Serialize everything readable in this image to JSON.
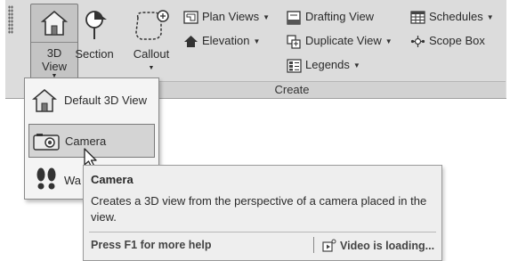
{
  "ribbon": {
    "panel_label": "Create",
    "view3d": {
      "line1": "3D",
      "line2": "View",
      "icon": "house-icon"
    },
    "section": {
      "label": "Section",
      "icon": "section-marker-icon"
    },
    "callout": {
      "label": "Callout",
      "icon": "callout-icon"
    },
    "plan_views": {
      "label": "Plan Views",
      "icon": "plan-views-icon"
    },
    "elevation": {
      "label": "Elevation",
      "icon": "elevation-icon"
    },
    "drafting_view": {
      "label": "Drafting View",
      "icon": "drafting-view-icon"
    },
    "duplicate_view": {
      "label": "Duplicate View",
      "icon": "duplicate-view-icon"
    },
    "legends": {
      "label": "Legends",
      "icon": "legends-icon"
    },
    "schedules": {
      "label": "Schedules",
      "icon": "schedules-icon"
    },
    "scope_box": {
      "label": "Scope Box",
      "icon": "scope-box-icon"
    }
  },
  "dropdown": {
    "items": [
      {
        "label": "Default 3D View",
        "icon": "house-icon"
      },
      {
        "label": "Camera",
        "icon": "camera-icon"
      },
      {
        "label": "Wa",
        "icon": "footprints-icon"
      }
    ]
  },
  "tooltip": {
    "title": "Camera",
    "description": "Creates a 3D view from the perspective of a camera placed in the view.",
    "help": "Press F1 for more help",
    "video": "Video is loading..."
  },
  "colors": {
    "ribbon_bg": "#dcdcdc",
    "highlight": "#c4c4c4",
    "tooltip_bg": "#eeeeee"
  }
}
